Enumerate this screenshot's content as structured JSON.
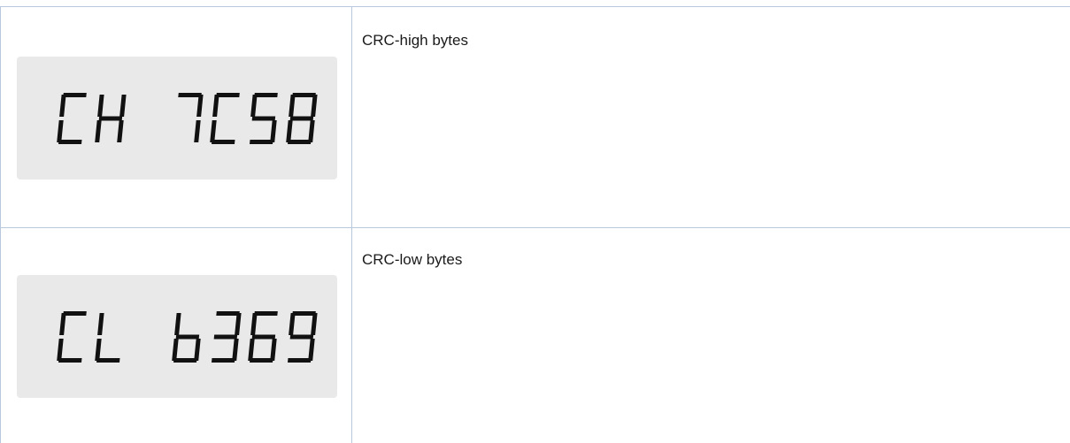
{
  "rows": [
    {
      "display_text": "CH 7C58",
      "display_groups": [
        "CH",
        "7C58"
      ],
      "description": "CRC-high bytes"
    },
    {
      "display_text": "CL b369",
      "display_groups": [
        "CL",
        "b369"
      ],
      "description": "CRC-low bytes"
    }
  ],
  "colors": {
    "border": "#b9c8dd",
    "panel_background": "#e9e9e9",
    "segment": "#111111",
    "text": "#1a1a1a"
  }
}
